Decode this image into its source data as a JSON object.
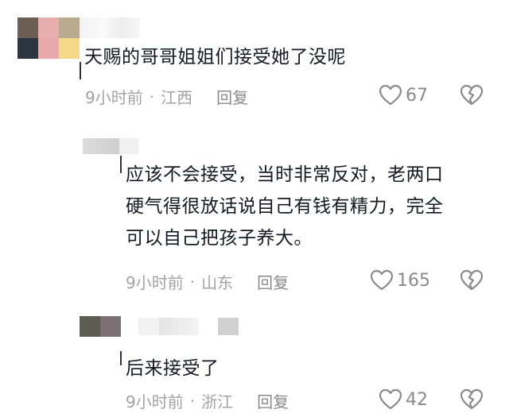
{
  "comments": [
    {
      "text_lines": [
        "天赐的哥哥姐姐们接受她了没呢"
      ],
      "time": "9小时前",
      "location": "江西",
      "reply_label": "回复",
      "likes": "67"
    },
    {
      "text_lines": [
        "应该不会接受，当时非常反对，老两口",
        "硬气得很放话说自己有钱有精力，完全",
        "可以自己把孩子养大。"
      ],
      "time": "9小时前",
      "location": "山东",
      "reply_label": "回复",
      "likes": "165"
    },
    {
      "text_lines": [
        "后来接受了"
      ],
      "time": "9小时前",
      "location": "浙江",
      "reply_label": "回复",
      "likes": "42"
    }
  ],
  "separator": "·",
  "icons": {
    "like": "heart-outline-icon",
    "dislike": "broken-heart-icon"
  }
}
